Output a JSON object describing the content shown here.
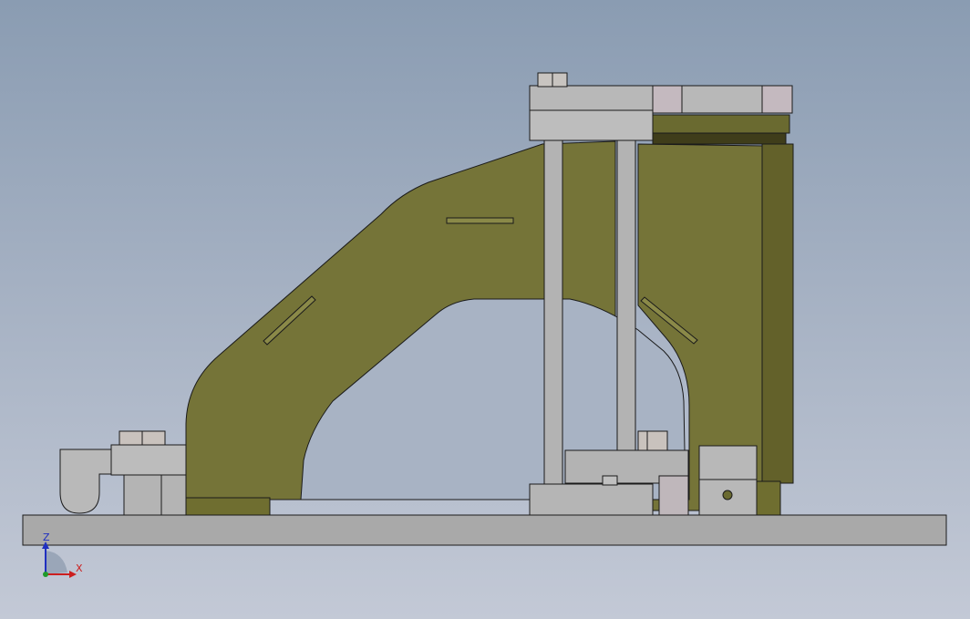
{
  "triad": {
    "z_label": "Z",
    "x_label": "X",
    "z_color": "#1f2fc0",
    "x_color": "#cc1f1f",
    "y_color": "#1f9a2a"
  },
  "colors": {
    "body_olive": "#757438",
    "body_olive_dark": "#5e5c24",
    "steel": "#b9b9b9",
    "steel_dark": "#9d9d9d",
    "steel_light": "#cfcfcf",
    "bolt": "#c9c2bd",
    "edge": "#1a1a1a"
  }
}
